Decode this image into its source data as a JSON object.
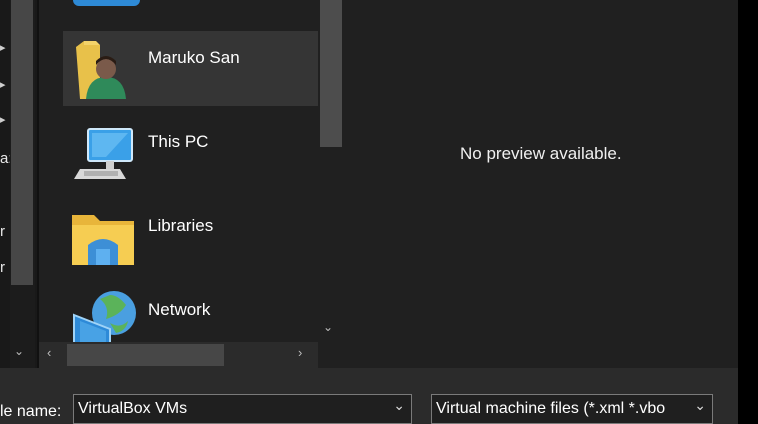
{
  "nav_fragments": {
    "text_a": "a:",
    "text_r1": "r",
    "text_r2": "r"
  },
  "list": {
    "items": [
      {
        "label": "Maruko San",
        "icon": "user-folder-icon",
        "selected": true
      },
      {
        "label": "This PC",
        "icon": "computer-icon",
        "selected": false
      },
      {
        "label": "Libraries",
        "icon": "libraries-icon",
        "selected": false
      },
      {
        "label": "Network",
        "icon": "network-icon",
        "selected": false
      }
    ]
  },
  "preview": {
    "message": "No preview available."
  },
  "footer": {
    "file_name_label": "le name:",
    "file_name_value": "VirtualBox VMs",
    "file_type_value": "Virtual machine files (*.xml *.vbo"
  },
  "colors": {
    "background": "#202020",
    "selected": "#353535",
    "footer": "#2b2b2b"
  }
}
